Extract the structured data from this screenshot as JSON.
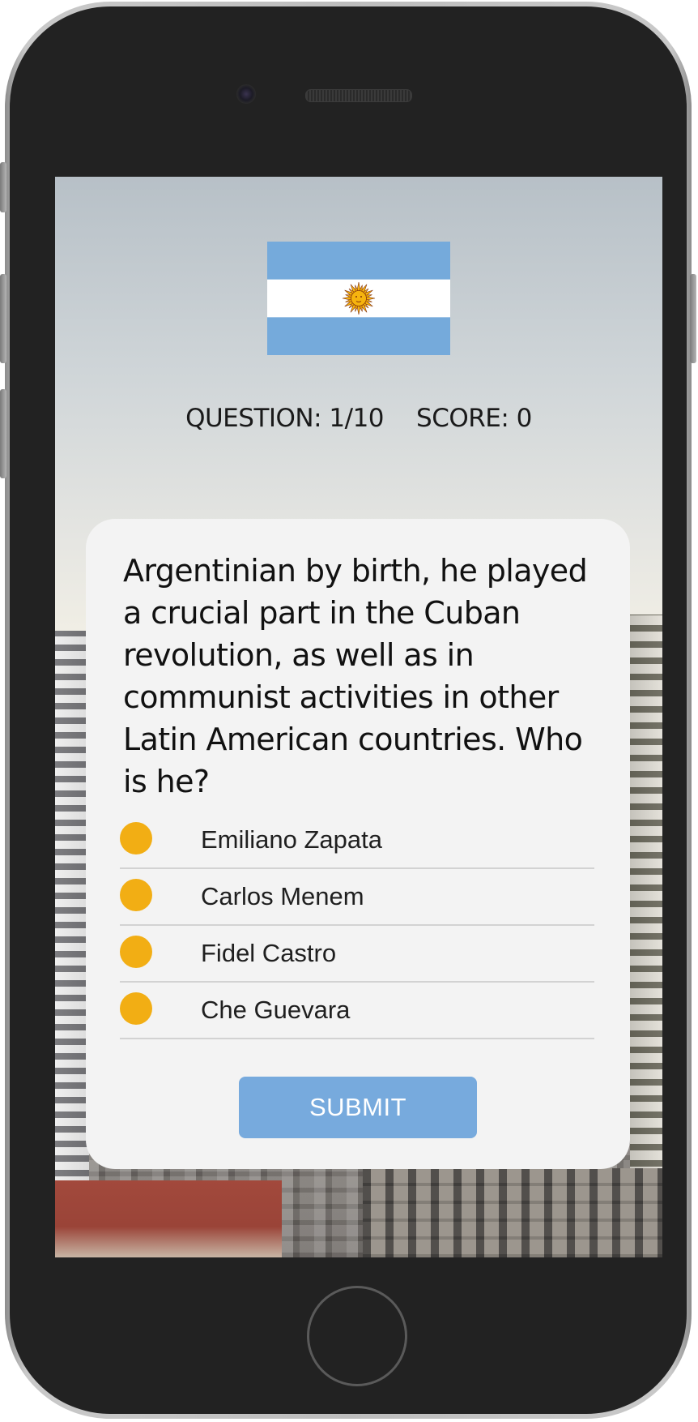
{
  "quiz": {
    "flag_icon": "argentina-flag-icon",
    "question_label": "QUESTION: 1/10",
    "score_label": "SCORE: 0",
    "question_text": "Argentinian by birth, he played a crucial part in the Cuban revolution, as well as in communist activities in other Latin American countries. Who is he?",
    "options": [
      {
        "label": "Emiliano Zapata"
      },
      {
        "label": "Carlos Menem"
      },
      {
        "label": "Fidel Castro"
      },
      {
        "label": "Che Guevara"
      }
    ],
    "submit_label": "SUBMIT"
  },
  "colors": {
    "flag_blue": "#75aadb",
    "sun": "#f6b40e",
    "radio": "#f2ae14",
    "submit_bg": "#77aadd",
    "card_bg": "#f3f3f3",
    "phone_body": "#222222"
  }
}
